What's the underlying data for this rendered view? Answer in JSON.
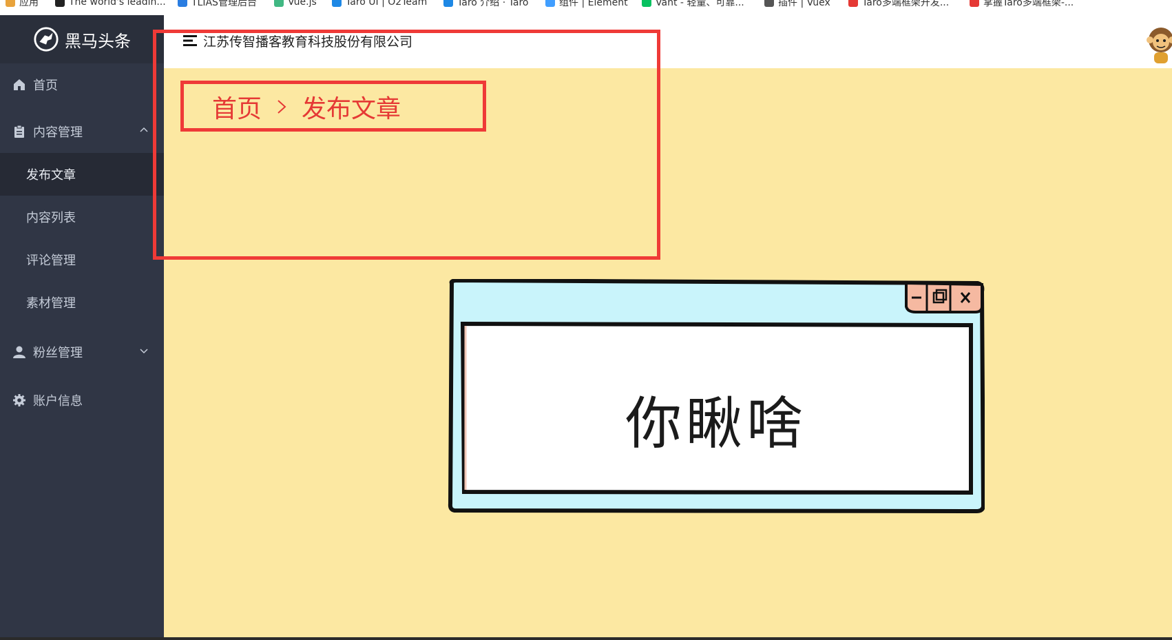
{
  "bookmarks": [
    {
      "label": "应用",
      "color": "#e8a33c"
    },
    {
      "label": "The world's leadin...",
      "color": "#222222"
    },
    {
      "label": "TLIAS管理后台",
      "color": "#2a7de1"
    },
    {
      "label": "Vue.js",
      "color": "#41b883"
    },
    {
      "label": "Taro UI | O2Team",
      "color": "#1e88e5"
    },
    {
      "label": "Taro 介绍 · Taro",
      "color": "#1e88e5"
    },
    {
      "label": "组件 | Element",
      "color": "#409eff"
    },
    {
      "label": "Vant - 轻量、可靠...",
      "color": "#07c160"
    },
    {
      "label": "插件 | Vuex",
      "color": "#555555"
    },
    {
      "label": "Taro多端框架开发...",
      "color": "#e53935"
    },
    {
      "label": "掌握Taro多端框架-...",
      "color": "#e53935"
    }
  ],
  "sidebar": {
    "logo_text": "黑马头条",
    "items": {
      "home": {
        "label": "首页",
        "icon": "home-icon"
      },
      "content": {
        "label": "内容管理",
        "icon": "document-icon"
      },
      "publish": {
        "label": "发布文章"
      },
      "list": {
        "label": "内容列表"
      },
      "comments": {
        "label": "评论管理"
      },
      "materials": {
        "label": "素材管理"
      },
      "fans": {
        "label": "粉丝管理",
        "icon": "user-icon"
      },
      "account": {
        "label": "账户信息",
        "icon": "gear-icon"
      }
    }
  },
  "header": {
    "company": "江苏传智播客教育科技股份有限公司"
  },
  "breadcrumb": {
    "home": "首页",
    "current": "发布文章"
  },
  "illustration": {
    "text": "你瞅啥"
  },
  "colors": {
    "sidebar_bg": "#303645",
    "main_bg": "#fce8a2",
    "highlight": "#ef3a37"
  }
}
